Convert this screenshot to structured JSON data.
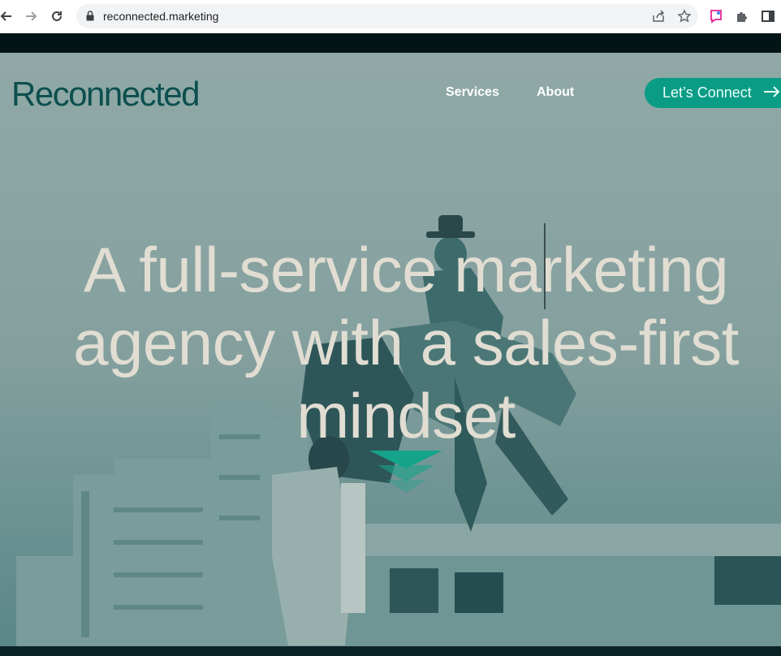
{
  "browser": {
    "url": "reconnected.marketing"
  },
  "site": {
    "logo": "Reconnected",
    "nav": {
      "services": "Services",
      "about": "About",
      "cta": "Let’s Connect"
    },
    "hero": {
      "line1": "A full-service marketing",
      "line2": "agency with a sales-first",
      "line3": "mindset"
    }
  },
  "colors": {
    "brand_dark": "#0b4f4e",
    "cta_bg": "#0b9c86",
    "headline": "#e1ddd2",
    "chevron": "#15a48b"
  },
  "icons": [
    "back-arrow-icon",
    "forward-arrow-icon",
    "reload-icon",
    "lock-icon",
    "share-icon",
    "star-icon",
    "extension-badge-icon",
    "puzzle-icon",
    "side-panel-icon",
    "arrow-right-icon",
    "scroll-down-chevron-icon"
  ]
}
